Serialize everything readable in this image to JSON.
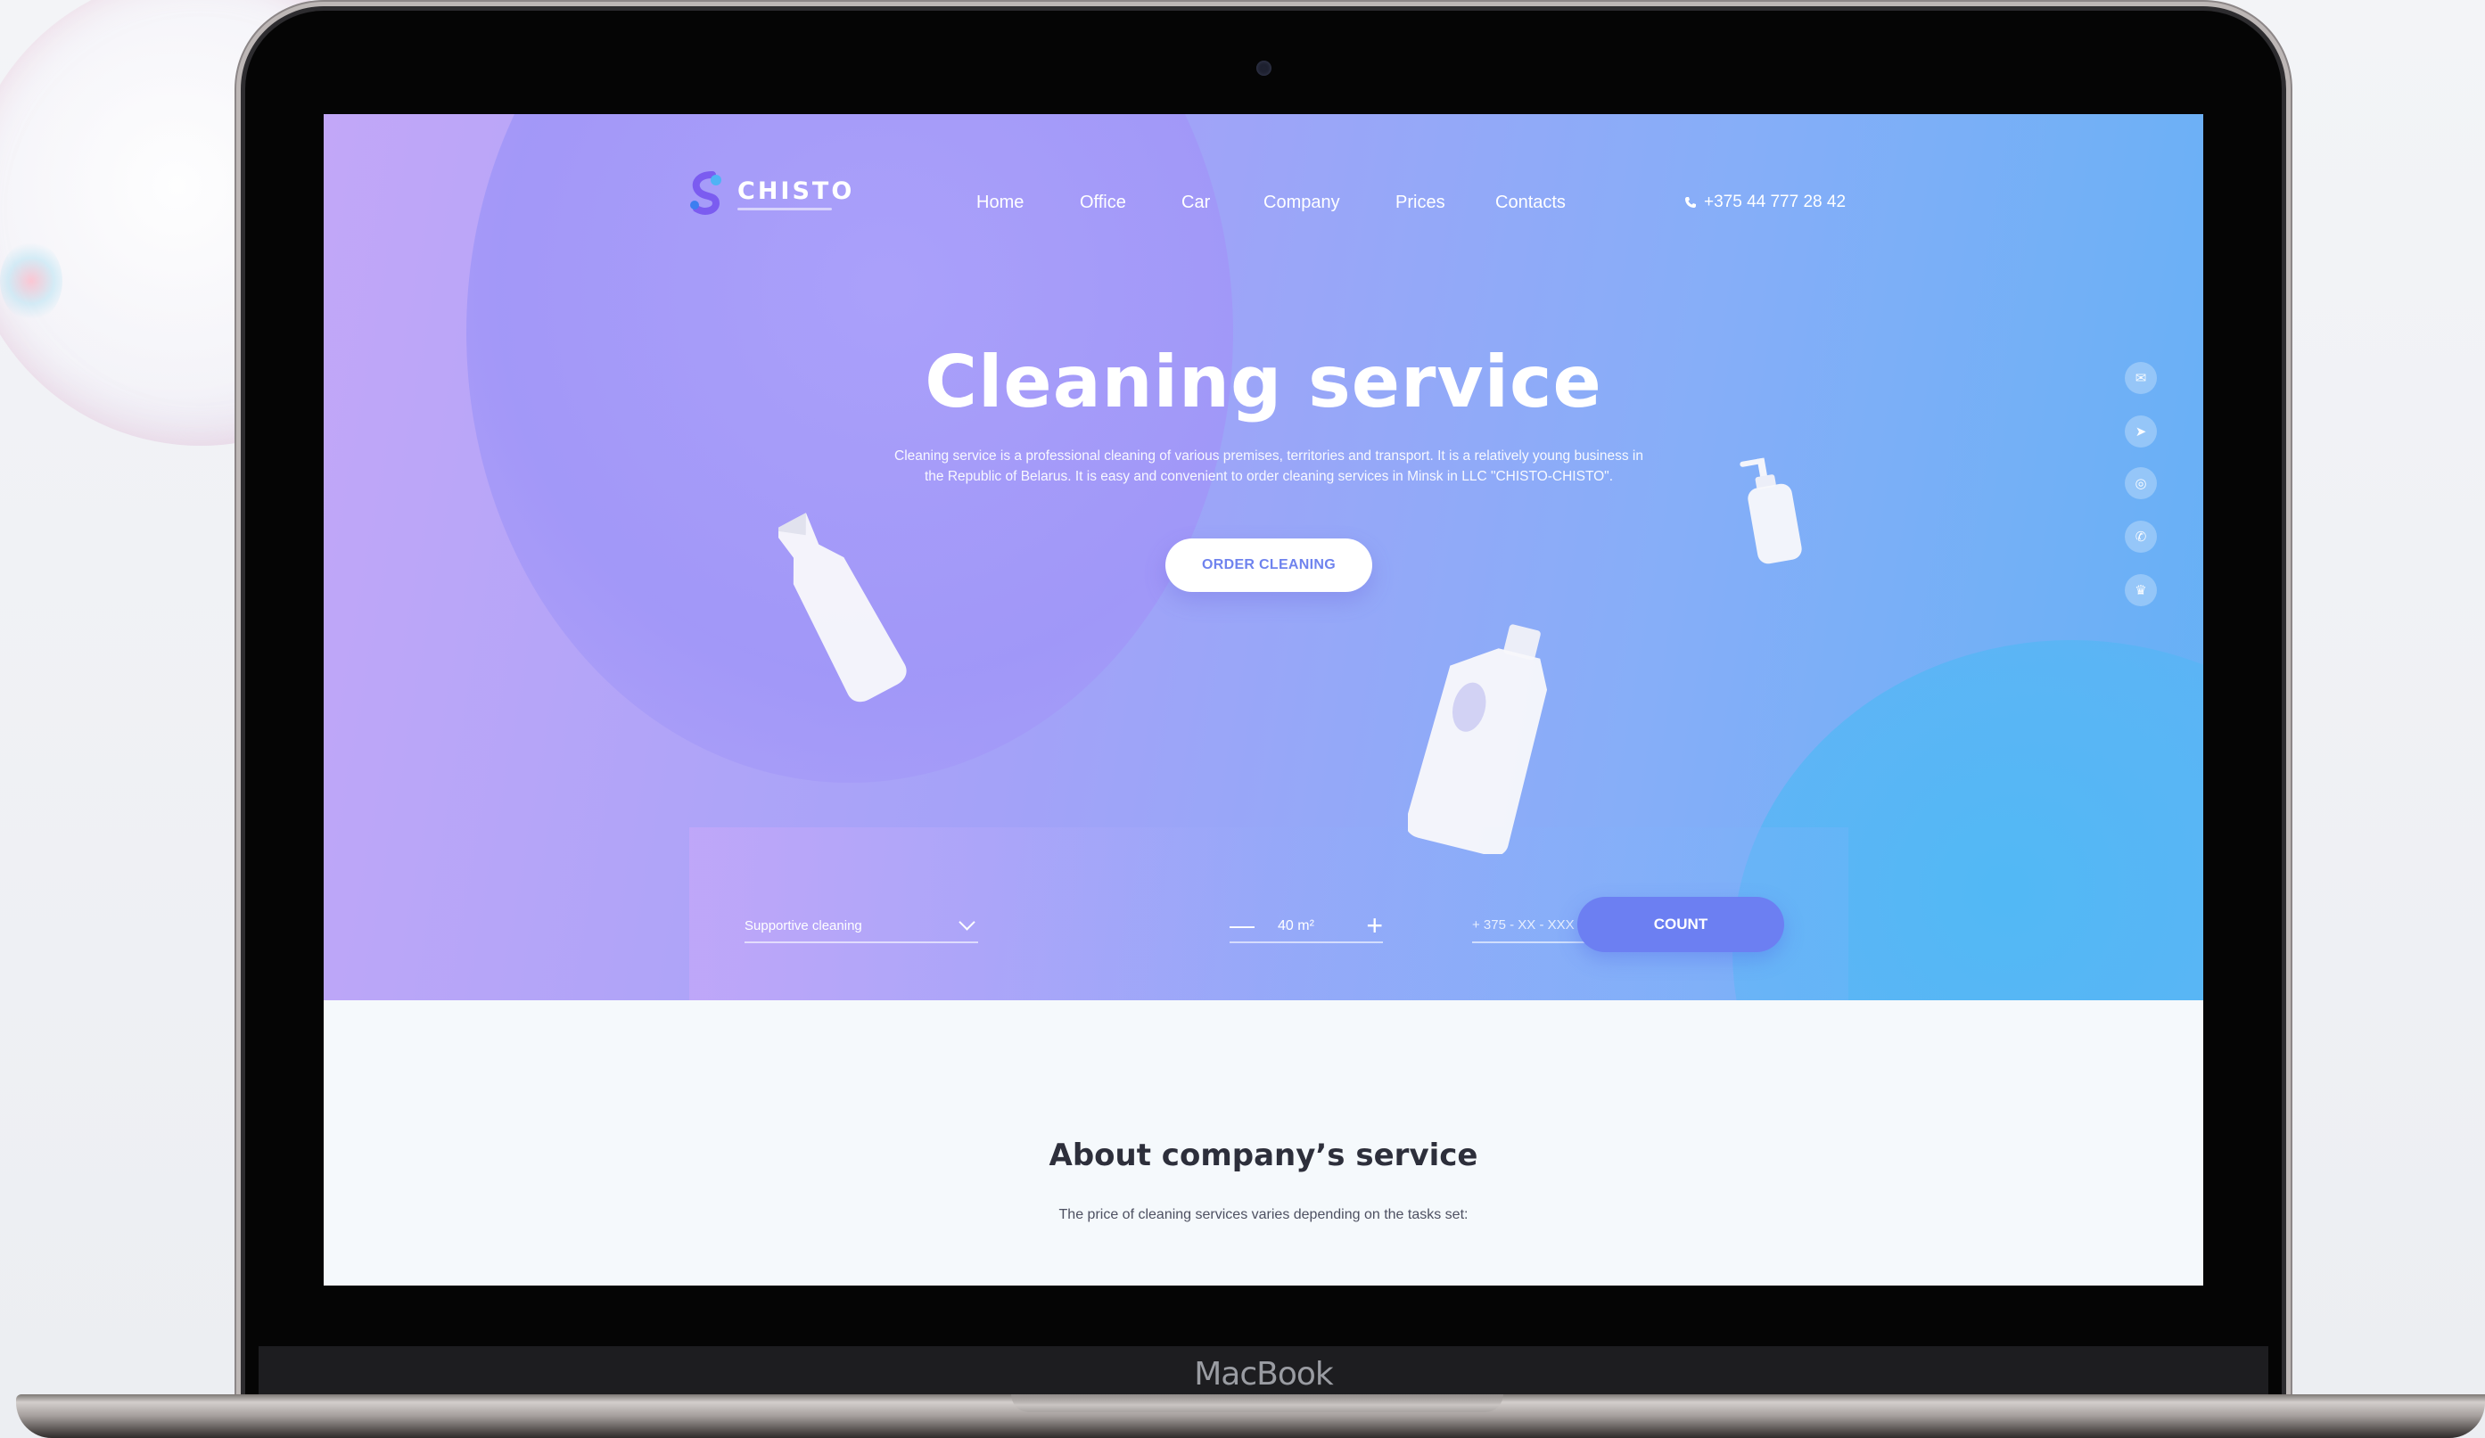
{
  "device": {
    "brand_label": "MacBook"
  },
  "site": {
    "logo": {
      "text": "CHISTO"
    },
    "nav": [
      {
        "label": "Home"
      },
      {
        "label": "Office"
      },
      {
        "label": "Car"
      },
      {
        "label": "Company"
      },
      {
        "label": "Prices"
      },
      {
        "label": "Contacts"
      }
    ],
    "phone": "+375 44 777 28 42",
    "hero": {
      "title": "Cleaning service",
      "description": "Cleaning service is a professional cleaning of various premises, territories and transport. It is a relatively young business in the Republic of Belarus. It is easy and convenient to order cleaning services in Minsk in LLC \"CHISTO-CHISTO\".",
      "cta_label": "ORDER CLEANING"
    },
    "social_icons": [
      "mail-icon",
      "telegram-icon",
      "instagram-icon",
      "viber-icon",
      "vk-icon"
    ],
    "calculator": {
      "service_select": "Supportive cleaning",
      "area_value": "40 m²",
      "minus_label": "—",
      "plus_label": "+",
      "phone_placeholder": "+ 375 - XX - XXX - XX - XX",
      "count_label": "COUNT"
    },
    "about": {
      "title": "About company’s service",
      "subtitle": "The price of cleaning services varies depending on the tasks set:"
    }
  },
  "colors": {
    "hero_left": "#c2a7f8",
    "hero_right": "#64b1f5",
    "button_accent": "#6c7ff2",
    "heading_dark": "#2d2f3b"
  }
}
